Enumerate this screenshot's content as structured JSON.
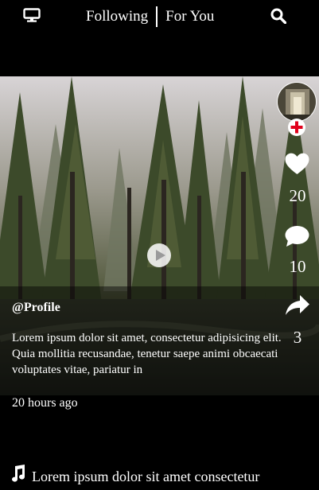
{
  "header": {
    "tabs": [
      {
        "label": "Following",
        "active": false
      },
      {
        "label": "For You",
        "active": true
      }
    ],
    "left_icon": "tv-icon",
    "right_icon": "search-icon"
  },
  "post": {
    "username": "@Profile",
    "caption": "Lorem ipsum dolor sit amet, consectetur adipisicing elit. Quia mollitia recusandae, tenetur saepe animi obcaecati voluptates vitae, pariatur in",
    "time_ago": "20 hours ago",
    "sound": "Lorem ipsum dolor sit amet consectetur"
  },
  "actions": {
    "likes": "20",
    "comments": "10",
    "shares": "3"
  },
  "colors": {
    "background": "#000000",
    "text": "#ffffff",
    "follow_accent": "#e0001b"
  },
  "icons": [
    "tv-icon",
    "search-icon",
    "play-icon",
    "plus-icon",
    "heart-icon",
    "comment-icon",
    "share-icon",
    "music-note-icon"
  ]
}
